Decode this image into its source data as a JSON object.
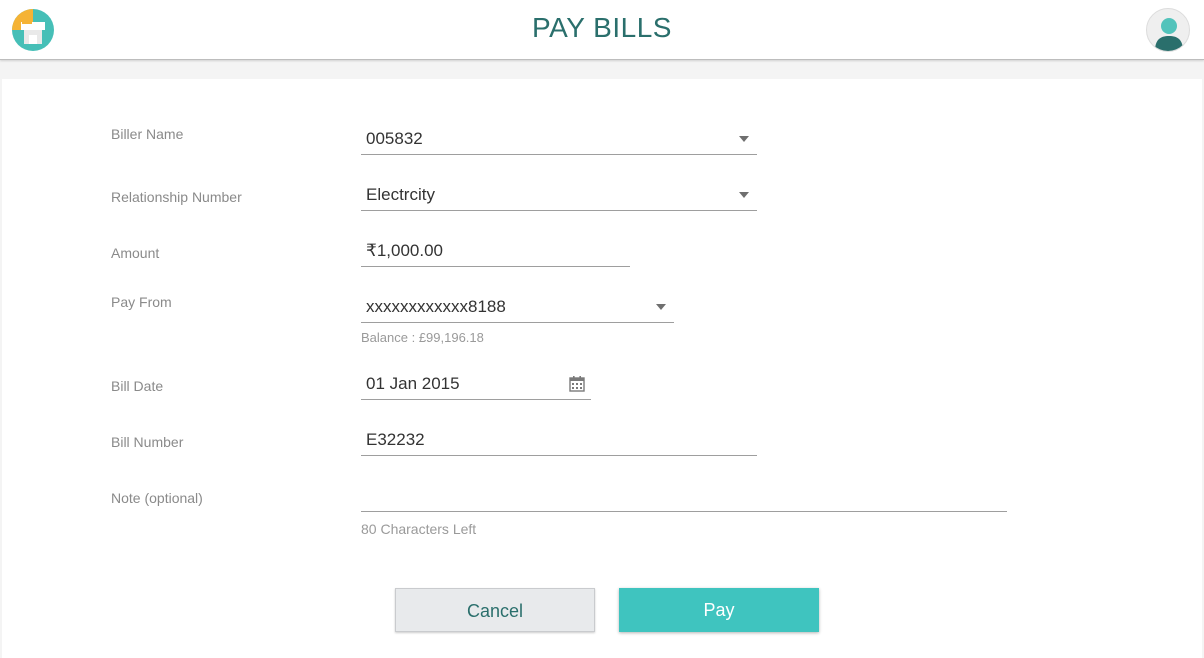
{
  "header": {
    "title": "PAY BILLS",
    "logo_icon": "store-icon",
    "avatar_icon": "user-avatar-icon"
  },
  "form": {
    "biller_name": {
      "label": "Biller Name",
      "value": "005832"
    },
    "relationship_number": {
      "label": "Relationship Number",
      "value": "Electrcity"
    },
    "amount": {
      "label": "Amount",
      "value": "₹1,000.00"
    },
    "pay_from": {
      "label": "Pay From",
      "value": "xxxxxxxxxxxx8188",
      "balance": "Balance : £99,196.18"
    },
    "bill_date": {
      "label": "Bill Date",
      "value": "01 Jan 2015"
    },
    "bill_number": {
      "label": "Bill Number",
      "value": "E32232"
    },
    "note": {
      "label": "Note (optional)",
      "value": "",
      "chars_left": "80 Characters Left"
    }
  },
  "actions": {
    "cancel_label": "Cancel",
    "pay_label": "Pay"
  },
  "colors": {
    "accent": "#3fc4bf",
    "title": "#2a6f6c"
  }
}
